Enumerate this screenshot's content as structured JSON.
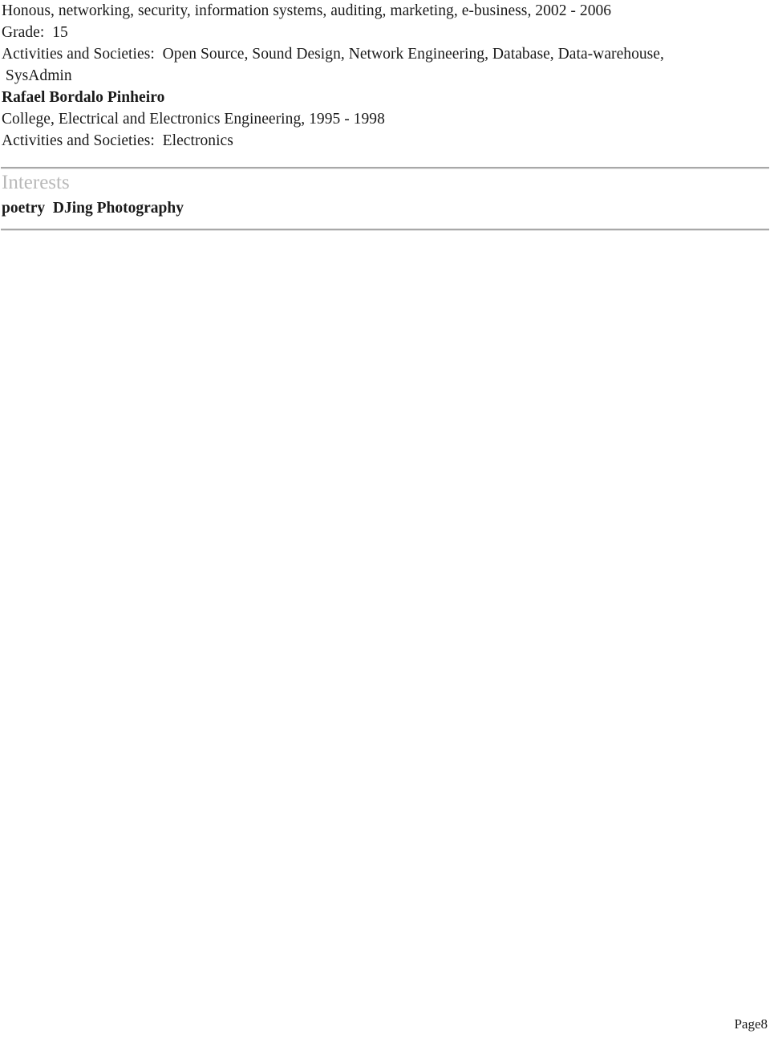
{
  "document": {
    "body_lines": [
      {
        "text": "Honous, networking, security, information systems, auditing, marketing, e-business, 2002 - 2006",
        "bold": false
      },
      {
        "text": "Grade:  15",
        "bold": false
      },
      {
        "text": "Activities and Societies:  Open Source, Sound Design, Network Engineering, Database, Data-warehouse,",
        "bold": false
      },
      {
        "text": " SysAdmin",
        "bold": false
      },
      {
        "text": "Rafael Bordalo Pinheiro",
        "bold": true
      },
      {
        "text": "College, Electrical and Electronics Engineering, 1995 - 1998",
        "bold": false
      },
      {
        "text": "Activities and Societies:  Electronics",
        "bold": false
      }
    ],
    "interests_section": {
      "heading": "Interests",
      "items_line": "poetry  DJing Photography"
    },
    "footer": {
      "page_label": "Page8"
    },
    "colors": {
      "text": "#1a1a1a",
      "section_heading": "#b8b8b8",
      "rule": "#a8a8a8",
      "background": "#ffffff"
    }
  }
}
